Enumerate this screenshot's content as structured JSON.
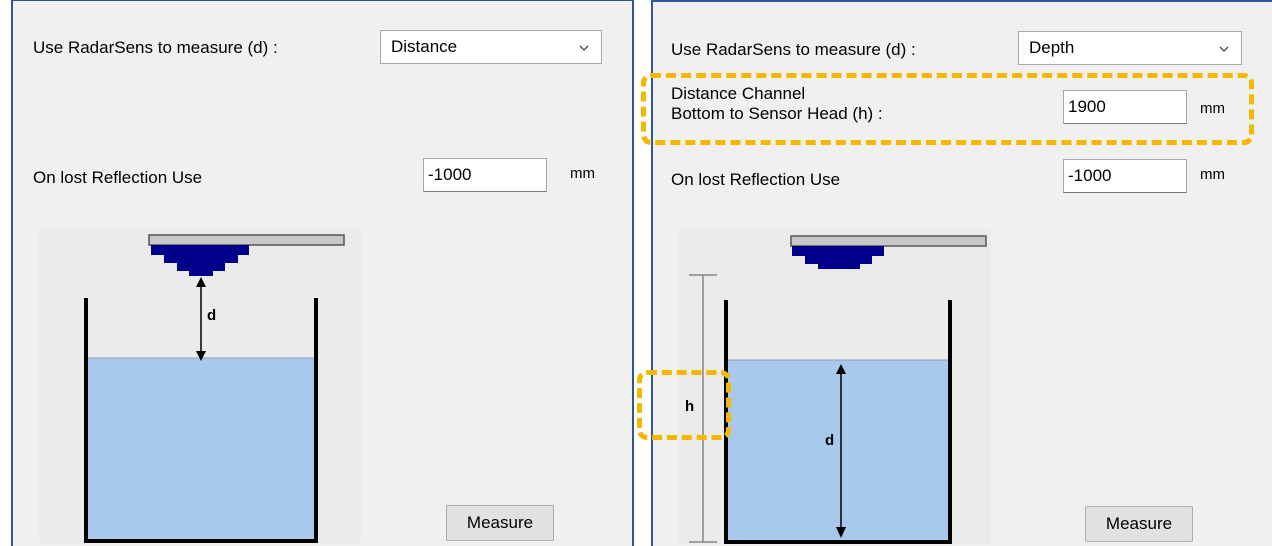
{
  "left_panel": {
    "measure_label": "Use RadarSens to measure (d) :",
    "measure_value": "Distance",
    "lost_reflection_label": "On lost Reflection Use",
    "lost_reflection_value": "-1000",
    "lost_reflection_unit": "mm",
    "diagram_label_d": "d",
    "measure_button": "Measure"
  },
  "right_panel": {
    "measure_label": "Use RadarSens to measure (d) :",
    "measure_value": "Depth",
    "distance_channel_label_line1": "Distance Channel",
    "distance_channel_label_line2": "Bottom to Sensor Head (h) :",
    "distance_channel_value": "1900",
    "distance_channel_unit": "mm",
    "lost_reflection_label": "On lost Reflection Use",
    "lost_reflection_value": "-1000",
    "lost_reflection_unit": "mm",
    "diagram_label_h": "h",
    "diagram_label_d": "d",
    "measure_button": "Measure"
  },
  "colors": {
    "panel_border": "#2f5597",
    "highlight": "#f5b800",
    "sensor": "#00008b",
    "liquid": "#a8c8ec"
  }
}
